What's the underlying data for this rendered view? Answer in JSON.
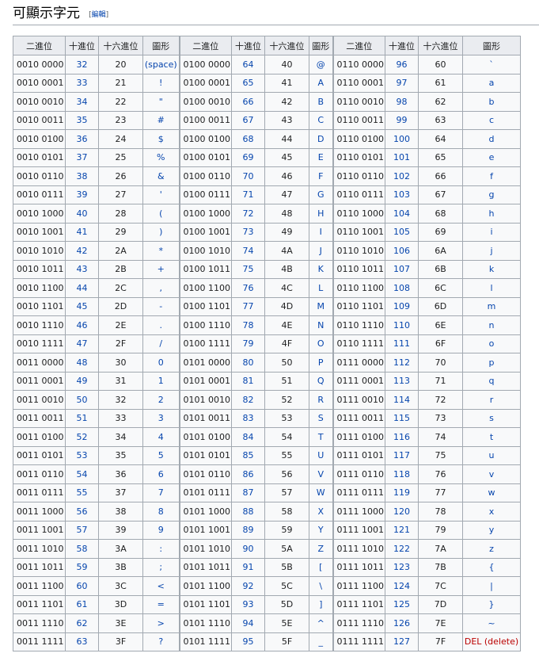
{
  "section": {
    "title": "可顯示字元",
    "edit_open": "[",
    "edit_label": "編輯",
    "edit_close": "]"
  },
  "headers": [
    "二進位",
    "十進位",
    "十六進位",
    "圖形"
  ],
  "colors": {
    "link": "#0645ad",
    "red_link": "#ba0000",
    "header_bg": "#eaecf0",
    "cell_bg": "#f8f9fa",
    "border": "#a2a9b1"
  },
  "groups": [
    {
      "rows": [
        {
          "bin": "0010 0000",
          "dec": "32",
          "hex": "20",
          "glyph": "(space)"
        },
        {
          "bin": "0010 0001",
          "dec": "33",
          "hex": "21",
          "glyph": "!"
        },
        {
          "bin": "0010 0010",
          "dec": "34",
          "hex": "22",
          "glyph": "\""
        },
        {
          "bin": "0010 0011",
          "dec": "35",
          "hex": "23",
          "glyph": "#"
        },
        {
          "bin": "0010 0100",
          "dec": "36",
          "hex": "24",
          "glyph": "$"
        },
        {
          "bin": "0010 0101",
          "dec": "37",
          "hex": "25",
          "glyph": "%"
        },
        {
          "bin": "0010 0110",
          "dec": "38",
          "hex": "26",
          "glyph": "&"
        },
        {
          "bin": "0010 0111",
          "dec": "39",
          "hex": "27",
          "glyph": "'"
        },
        {
          "bin": "0010 1000",
          "dec": "40",
          "hex": "28",
          "glyph": "("
        },
        {
          "bin": "0010 1001",
          "dec": "41",
          "hex": "29",
          "glyph": ")"
        },
        {
          "bin": "0010 1010",
          "dec": "42",
          "hex": "2A",
          "glyph": "*"
        },
        {
          "bin": "0010 1011",
          "dec": "43",
          "hex": "2B",
          "glyph": "+"
        },
        {
          "bin": "0010 1100",
          "dec": "44",
          "hex": "2C",
          "glyph": ","
        },
        {
          "bin": "0010 1101",
          "dec": "45",
          "hex": "2D",
          "glyph": "-"
        },
        {
          "bin": "0010 1110",
          "dec": "46",
          "hex": "2E",
          "glyph": "."
        },
        {
          "bin": "0010 1111",
          "dec": "47",
          "hex": "2F",
          "glyph": "/"
        },
        {
          "bin": "0011 0000",
          "dec": "48",
          "hex": "30",
          "glyph": "0"
        },
        {
          "bin": "0011 0001",
          "dec": "49",
          "hex": "31",
          "glyph": "1"
        },
        {
          "bin": "0011 0010",
          "dec": "50",
          "hex": "32",
          "glyph": "2"
        },
        {
          "bin": "0011 0011",
          "dec": "51",
          "hex": "33",
          "glyph": "3"
        },
        {
          "bin": "0011 0100",
          "dec": "52",
          "hex": "34",
          "glyph": "4"
        },
        {
          "bin": "0011 0101",
          "dec": "53",
          "hex": "35",
          "glyph": "5"
        },
        {
          "bin": "0011 0110",
          "dec": "54",
          "hex": "36",
          "glyph": "6"
        },
        {
          "bin": "0011 0111",
          "dec": "55",
          "hex": "37",
          "glyph": "7"
        },
        {
          "bin": "0011 1000",
          "dec": "56",
          "hex": "38",
          "glyph": "8"
        },
        {
          "bin": "0011 1001",
          "dec": "57",
          "hex": "39",
          "glyph": "9"
        },
        {
          "bin": "0011 1010",
          "dec": "58",
          "hex": "3A",
          "glyph": ":"
        },
        {
          "bin": "0011 1011",
          "dec": "59",
          "hex": "3B",
          "glyph": ";"
        },
        {
          "bin": "0011 1100",
          "dec": "60",
          "hex": "3C",
          "glyph": "<"
        },
        {
          "bin": "0011 1101",
          "dec": "61",
          "hex": "3D",
          "glyph": "="
        },
        {
          "bin": "0011 1110",
          "dec": "62",
          "hex": "3E",
          "glyph": ">"
        },
        {
          "bin": "0011 1111",
          "dec": "63",
          "hex": "3F",
          "glyph": "?"
        }
      ]
    },
    {
      "rows": [
        {
          "bin": "0100 0000",
          "dec": "64",
          "hex": "40",
          "glyph": "@"
        },
        {
          "bin": "0100 0001",
          "dec": "65",
          "hex": "41",
          "glyph": "A"
        },
        {
          "bin": "0100 0010",
          "dec": "66",
          "hex": "42",
          "glyph": "B"
        },
        {
          "bin": "0100 0011",
          "dec": "67",
          "hex": "43",
          "glyph": "C"
        },
        {
          "bin": "0100 0100",
          "dec": "68",
          "hex": "44",
          "glyph": "D"
        },
        {
          "bin": "0100 0101",
          "dec": "69",
          "hex": "45",
          "glyph": "E"
        },
        {
          "bin": "0100 0110",
          "dec": "70",
          "hex": "46",
          "glyph": "F"
        },
        {
          "bin": "0100 0111",
          "dec": "71",
          "hex": "47",
          "glyph": "G"
        },
        {
          "bin": "0100 1000",
          "dec": "72",
          "hex": "48",
          "glyph": "H"
        },
        {
          "bin": "0100 1001",
          "dec": "73",
          "hex": "49",
          "glyph": "I"
        },
        {
          "bin": "0100 1010",
          "dec": "74",
          "hex": "4A",
          "glyph": "J"
        },
        {
          "bin": "0100 1011",
          "dec": "75",
          "hex": "4B",
          "glyph": "K"
        },
        {
          "bin": "0100 1100",
          "dec": "76",
          "hex": "4C",
          "glyph": "L"
        },
        {
          "bin": "0100 1101",
          "dec": "77",
          "hex": "4D",
          "glyph": "M"
        },
        {
          "bin": "0100 1110",
          "dec": "78",
          "hex": "4E",
          "glyph": "N"
        },
        {
          "bin": "0100 1111",
          "dec": "79",
          "hex": "4F",
          "glyph": "O"
        },
        {
          "bin": "0101 0000",
          "dec": "80",
          "hex": "50",
          "glyph": "P"
        },
        {
          "bin": "0101 0001",
          "dec": "81",
          "hex": "51",
          "glyph": "Q"
        },
        {
          "bin": "0101 0010",
          "dec": "82",
          "hex": "52",
          "glyph": "R"
        },
        {
          "bin": "0101 0011",
          "dec": "83",
          "hex": "53",
          "glyph": "S"
        },
        {
          "bin": "0101 0100",
          "dec": "84",
          "hex": "54",
          "glyph": "T"
        },
        {
          "bin": "0101 0101",
          "dec": "85",
          "hex": "55",
          "glyph": "U"
        },
        {
          "bin": "0101 0110",
          "dec": "86",
          "hex": "56",
          "glyph": "V"
        },
        {
          "bin": "0101 0111",
          "dec": "87",
          "hex": "57",
          "glyph": "W"
        },
        {
          "bin": "0101 1000",
          "dec": "88",
          "hex": "58",
          "glyph": "X"
        },
        {
          "bin": "0101 1001",
          "dec": "89",
          "hex": "59",
          "glyph": "Y"
        },
        {
          "bin": "0101 1010",
          "dec": "90",
          "hex": "5A",
          "glyph": "Z"
        },
        {
          "bin": "0101 1011",
          "dec": "91",
          "hex": "5B",
          "glyph": "["
        },
        {
          "bin": "0101 1100",
          "dec": "92",
          "hex": "5C",
          "glyph": "\\"
        },
        {
          "bin": "0101 1101",
          "dec": "93",
          "hex": "5D",
          "glyph": "]"
        },
        {
          "bin": "0101 1110",
          "dec": "94",
          "hex": "5E",
          "glyph": "^"
        },
        {
          "bin": "0101 1111",
          "dec": "95",
          "hex": "5F",
          "glyph": "_"
        }
      ]
    },
    {
      "rows": [
        {
          "bin": "0110 0000",
          "dec": "96",
          "hex": "60",
          "glyph": "`"
        },
        {
          "bin": "0110 0001",
          "dec": "97",
          "hex": "61",
          "glyph": "a"
        },
        {
          "bin": "0110 0010",
          "dec": "98",
          "hex": "62",
          "glyph": "b"
        },
        {
          "bin": "0110 0011",
          "dec": "99",
          "hex": "63",
          "glyph": "c"
        },
        {
          "bin": "0110 0100",
          "dec": "100",
          "hex": "64",
          "glyph": "d"
        },
        {
          "bin": "0110 0101",
          "dec": "101",
          "hex": "65",
          "glyph": "e"
        },
        {
          "bin": "0110 0110",
          "dec": "102",
          "hex": "66",
          "glyph": "f"
        },
        {
          "bin": "0110 0111",
          "dec": "103",
          "hex": "67",
          "glyph": "g"
        },
        {
          "bin": "0110 1000",
          "dec": "104",
          "hex": "68",
          "glyph": "h"
        },
        {
          "bin": "0110 1001",
          "dec": "105",
          "hex": "69",
          "glyph": "i"
        },
        {
          "bin": "0110 1010",
          "dec": "106",
          "hex": "6A",
          "glyph": "j"
        },
        {
          "bin": "0110 1011",
          "dec": "107",
          "hex": "6B",
          "glyph": "k"
        },
        {
          "bin": "0110 1100",
          "dec": "108",
          "hex": "6C",
          "glyph": "l"
        },
        {
          "bin": "0110 1101",
          "dec": "109",
          "hex": "6D",
          "glyph": "m"
        },
        {
          "bin": "0110 1110",
          "dec": "110",
          "hex": "6E",
          "glyph": "n"
        },
        {
          "bin": "0110 1111",
          "dec": "111",
          "hex": "6F",
          "glyph": "o"
        },
        {
          "bin": "0111 0000",
          "dec": "112",
          "hex": "70",
          "glyph": "p"
        },
        {
          "bin": "0111 0001",
          "dec": "113",
          "hex": "71",
          "glyph": "q"
        },
        {
          "bin": "0111 0010",
          "dec": "114",
          "hex": "72",
          "glyph": "r"
        },
        {
          "bin": "0111 0011",
          "dec": "115",
          "hex": "73",
          "glyph": "s"
        },
        {
          "bin": "0111 0100",
          "dec": "116",
          "hex": "74",
          "glyph": "t"
        },
        {
          "bin": "0111 0101",
          "dec": "117",
          "hex": "75",
          "glyph": "u"
        },
        {
          "bin": "0111 0110",
          "dec": "118",
          "hex": "76",
          "glyph": "v"
        },
        {
          "bin": "0111 0111",
          "dec": "119",
          "hex": "77",
          "glyph": "w"
        },
        {
          "bin": "0111 1000",
          "dec": "120",
          "hex": "78",
          "glyph": "x"
        },
        {
          "bin": "0111 1001",
          "dec": "121",
          "hex": "79",
          "glyph": "y"
        },
        {
          "bin": "0111 1010",
          "dec": "122",
          "hex": "7A",
          "glyph": "z"
        },
        {
          "bin": "0111 1011",
          "dec": "123",
          "hex": "7B",
          "glyph": "{"
        },
        {
          "bin": "0111 1100",
          "dec": "124",
          "hex": "7C",
          "glyph": "|"
        },
        {
          "bin": "0111 1101",
          "dec": "125",
          "hex": "7D",
          "glyph": "}"
        },
        {
          "bin": "0111 1110",
          "dec": "126",
          "hex": "7E",
          "glyph": "~"
        },
        {
          "bin": "0111 1111",
          "dec": "127",
          "hex": "7F",
          "glyph": "DEL (delete)",
          "red": true
        }
      ]
    }
  ]
}
